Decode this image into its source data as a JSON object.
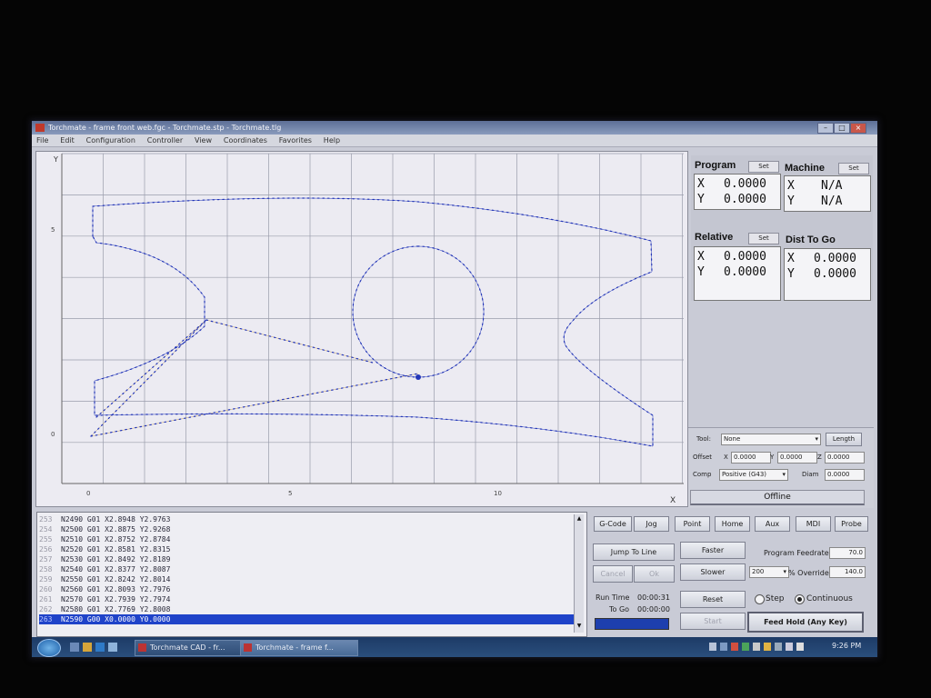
{
  "window": {
    "title": "Torchmate - frame front web.fgc - Torchmate.stp - Torchmate.tlg"
  },
  "menu": [
    "File",
    "Edit",
    "Configuration",
    "Controller",
    "View",
    "Coordinates",
    "Favorites",
    "Help"
  ],
  "plot": {
    "y_axis_label": "Y",
    "x_axis_label": "X",
    "x_ticks": [
      "0",
      "5",
      "10"
    ],
    "y_ticks": [
      "5",
      "0"
    ],
    "toolpath_color": "#2336b8",
    "rapid_color": "#c9a25a"
  },
  "program": {
    "title": "Program",
    "set": "Set",
    "x_label": "X",
    "y_label": "Y",
    "x": "0.0000",
    "y": "0.0000"
  },
  "machine": {
    "title": "Machine",
    "set": "Set",
    "x_label": "X",
    "y_label": "Y",
    "x": "N/A",
    "y": "N/A"
  },
  "relative": {
    "title": "Relative",
    "set": "Set",
    "x_label": "X",
    "y_label": "Y",
    "x": "0.0000",
    "y": "0.0000"
  },
  "dist_to_go": {
    "title": "Dist To Go",
    "x_label": "X",
    "y_label": "Y",
    "x": "0.0000",
    "y": "0.0000"
  },
  "tool": {
    "tool_label": "Tool:",
    "tool_value": "None",
    "length_button": "Length",
    "offset_label": "Offset",
    "x_label": "X",
    "x_value": "0.0000",
    "y_label": "Y",
    "y_value": "0.0000",
    "z_label": "Z",
    "z_value": "0.0000",
    "comp_label": "Comp",
    "comp_value": "Positive (G43)",
    "diam_label": "Diam",
    "diam_value": "0.0000",
    "status": "Offline"
  },
  "tabs": [
    "G-Code",
    "Jog",
    "Point",
    "Home",
    "Aux",
    "MDI",
    "Probe"
  ],
  "gcode_lines": [
    {
      "num": "253",
      "text": "N2490 G01 X2.8948 Y2.9763"
    },
    {
      "num": "254",
      "text": "N2500 G01 X2.8875 Y2.9268"
    },
    {
      "num": "255",
      "text": "N2510 G01 X2.8752 Y2.8784"
    },
    {
      "num": "256",
      "text": "N2520 G01 X2.8581 Y2.8315"
    },
    {
      "num": "257",
      "text": "N2530 G01 X2.8492 Y2.8189"
    },
    {
      "num": "258",
      "text": "N2540 G01 X2.8377 Y2.8087"
    },
    {
      "num": "259",
      "text": "N2550 G01 X2.8242 Y2.8014"
    },
    {
      "num": "260",
      "text": "N2560 G01 X2.8093 Y2.7976"
    },
    {
      "num": "261",
      "text": "N2570 G01 X2.7939 Y2.7974"
    },
    {
      "num": "262",
      "text": "N2580 G01 X2.7769 Y2.8008"
    },
    {
      "num": "263",
      "text": "N2590 G00 X0.0000 Y0.0000"
    }
  ],
  "controls": {
    "jump_to_line": "Jump To Line",
    "cancel": "Cancel",
    "ok": "Ok",
    "faster": "Faster",
    "slower": "Slower",
    "program_feedrate_label": "Program Feedrate",
    "program_feedrate": "70.0",
    "override_step": "200",
    "override_label": "% Override",
    "override_value": "140.0",
    "run_time_label": "Run Time",
    "run_time": "00:00:31",
    "to_go_label": "To Go",
    "to_go": "00:00:00",
    "reset": "Reset",
    "step": "Step",
    "continuous": "Continuous",
    "start": "Start",
    "feed_hold": "Feed Hold (Any Key)"
  },
  "taskbar": {
    "task1": "Torchmate CAD - fr...",
    "task2": "Torchmate - frame f...",
    "clock": "9:26 PM"
  }
}
